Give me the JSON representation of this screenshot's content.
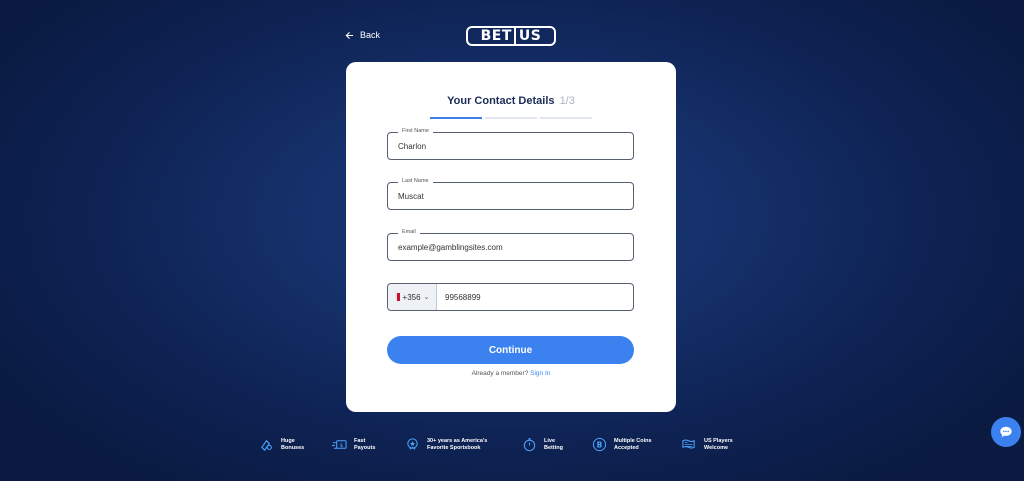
{
  "header": {
    "back_label": "Back",
    "logo_bet": "BET",
    "logo_us": "US"
  },
  "form": {
    "title": "Your Contact Details",
    "step": "1/3",
    "progress": {
      "current": 1,
      "total": 3
    },
    "first_name": {
      "label": "First Name",
      "value": "Charlon"
    },
    "last_name": {
      "label": "Last Name",
      "value": "Muscat"
    },
    "email": {
      "label": "Email",
      "value": "example@gamblingsites.com"
    },
    "phone": {
      "country_code": "+356",
      "number": "99568899"
    },
    "continue_label": "Continue",
    "member_text": "Already a member?",
    "sign_in_label": "Sign In"
  },
  "features": [
    {
      "icon": "gift-icon",
      "text": "Huge\nBonuses"
    },
    {
      "icon": "fast-payout-icon",
      "text": "Fast\nPayouts"
    },
    {
      "icon": "trophy-icon",
      "text": "30+ years as America's\nFavorite Sportsbook"
    },
    {
      "icon": "stopwatch-icon",
      "text": "Live\nBetting"
    },
    {
      "icon": "bitcoin-icon",
      "text": "Multiple Coins\nAccepted"
    },
    {
      "icon": "us-flag-icon",
      "text": "US Players\nWelcome"
    }
  ],
  "colors": {
    "accent": "#3b82f0",
    "background": "#13306a",
    "card": "#ffffff"
  }
}
